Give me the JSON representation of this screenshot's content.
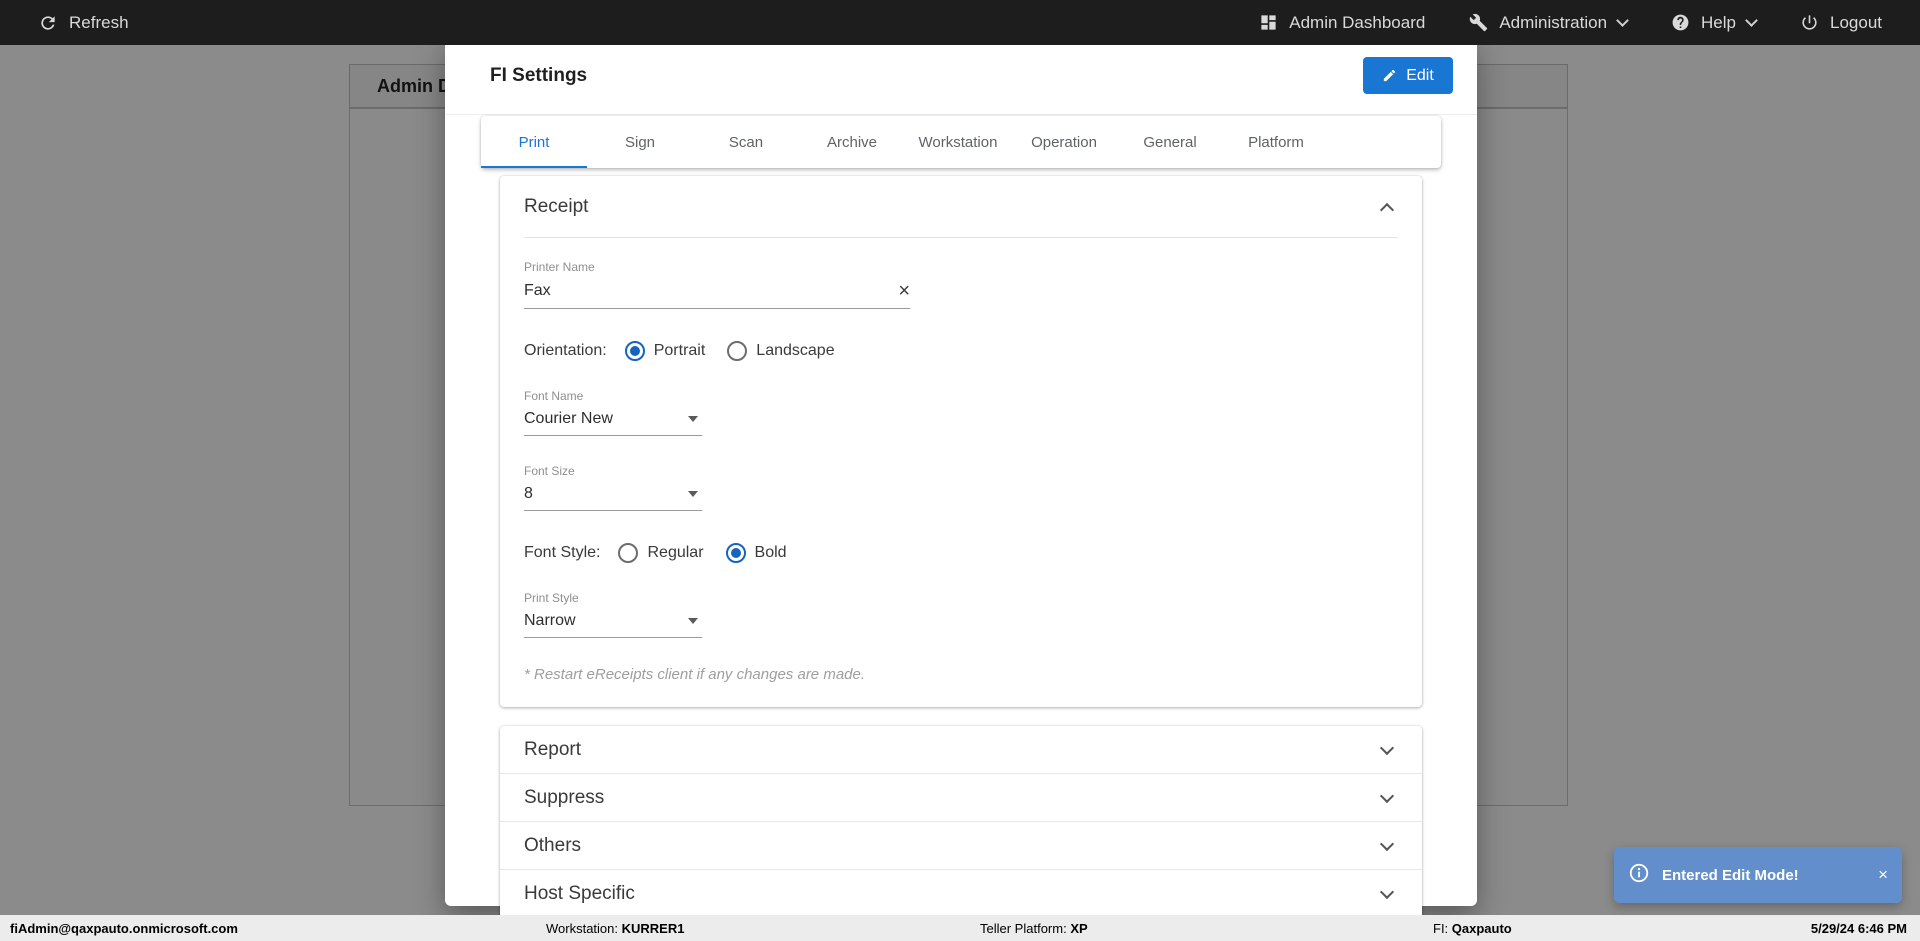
{
  "topbar": {
    "refresh_label": "Refresh",
    "admin_dashboard_label": "Admin Dashboard",
    "administration_label": "Administration",
    "help_label": "Help",
    "logout_label": "Logout"
  },
  "background_page": {
    "partial_title": "Admin D"
  },
  "modal": {
    "title": "FI Settings",
    "edit_button": "Edit",
    "tabs": [
      "Print",
      "Sign",
      "Scan",
      "Archive",
      "Workstation",
      "Operation",
      "General",
      "Platform"
    ],
    "active_tab": "Print",
    "receipt": {
      "title": "Receipt",
      "printer_name_label": "Printer Name",
      "printer_name_value": "Fax",
      "orientation_label": "Orientation:",
      "orientation_options": [
        "Portrait",
        "Landscape"
      ],
      "orientation_selected": "Portrait",
      "font_name_label": "Font Name",
      "font_name_value": "Courier New",
      "font_size_label": "Font Size",
      "font_size_value": "8",
      "font_style_label": "Font Style:",
      "font_style_options": [
        "Regular",
        "Bold"
      ],
      "font_style_selected": "Bold",
      "print_style_label": "Print Style",
      "print_style_value": "Narrow",
      "note": "* Restart eReceipts client if any changes are made."
    },
    "sections": [
      "Report",
      "Suppress",
      "Others",
      "Host Specific"
    ]
  },
  "footer": {
    "user_email": "fiAdmin@qaxpauto.onmicrosoft.com",
    "workstation_label": "Workstation: ",
    "workstation_value": "KURRER1",
    "teller_platform_label": "Teller Platform: ",
    "teller_platform_value": "XP",
    "fi_label": "FI: ",
    "fi_value": "Qaxpauto",
    "datetime": "5/29/24 6:46 PM"
  },
  "toast": {
    "message": "Entered Edit Mode!"
  },
  "colors": {
    "accent": "#1976d2",
    "radio_selected": "#1565c0",
    "topbar_bg": "#1d1d1d",
    "toast_bg": "rgba(91,143,214,0.85)"
  }
}
